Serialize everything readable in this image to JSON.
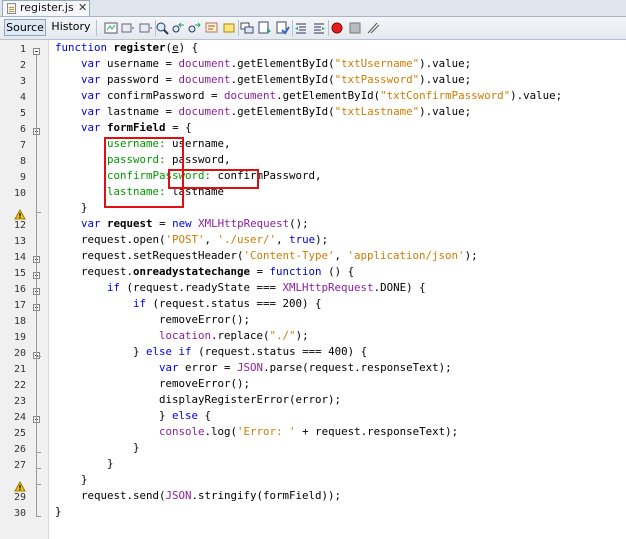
{
  "editor": {
    "tab_title": "register.js",
    "tab_close": "✕",
    "source_label": "Source",
    "history_label": "History"
  },
  "toolbar_icons": [
    "last-edit-icon",
    "back-icon",
    "forward-icon",
    "find-icon",
    "find-previous-icon",
    "find-next-icon",
    "find-selection-icon",
    "toggle-highlight-icon",
    "toggle-rectangular-icon",
    "toggle-bookmark-icon",
    "next-bookmark-icon",
    "shift-left-icon",
    "shift-right-icon",
    "record-macro-icon",
    "stop-macro-icon",
    "comment-icon"
  ],
  "gutter": {
    "line_numbers": [
      "1",
      "2",
      "3",
      "4",
      "5",
      "6",
      "7",
      "8",
      "9",
      "10",
      "11",
      "12",
      "13",
      "14",
      "15",
      "16",
      "17",
      "18",
      "19",
      "20",
      "21",
      "22",
      "23",
      "24",
      "25",
      "26",
      "27",
      "28",
      "29",
      "30"
    ],
    "warning_lines": [
      11,
      28
    ],
    "fold_lines": [
      1,
      6,
      14,
      15,
      16,
      17,
      20,
      24
    ]
  },
  "code_lines": [
    [
      {
        "t": "function",
        "c": "kw"
      },
      {
        "t": " "
      },
      {
        "t": "register",
        "c": "bold"
      },
      {
        "t": "("
      },
      {
        "t": "e",
        "c": "ul"
      },
      {
        "t": ") {"
      }
    ],
    [
      {
        "t": "    "
      },
      {
        "t": "var",
        "c": "kw"
      },
      {
        "t": " username = "
      },
      {
        "t": "document",
        "c": "glob"
      },
      {
        "t": ".getElementById("
      },
      {
        "t": "\"txtUsername\"",
        "c": "str"
      },
      {
        "t": ").value;"
      }
    ],
    [
      {
        "t": "    "
      },
      {
        "t": "var",
        "c": "kw"
      },
      {
        "t": " password = "
      },
      {
        "t": "document",
        "c": "glob"
      },
      {
        "t": ".getElementById("
      },
      {
        "t": "\"txtPassword\"",
        "c": "str"
      },
      {
        "t": ").value;"
      }
    ],
    [
      {
        "t": "    "
      },
      {
        "t": "var",
        "c": "kw"
      },
      {
        "t": " confirmPassword = "
      },
      {
        "t": "document",
        "c": "glob"
      },
      {
        "t": ".getElementById("
      },
      {
        "t": "\"txtConfirmPassword\"",
        "c": "str"
      },
      {
        "t": ").value;"
      }
    ],
    [
      {
        "t": "    "
      },
      {
        "t": "var",
        "c": "kw"
      },
      {
        "t": " lastname = "
      },
      {
        "t": "document",
        "c": "glob"
      },
      {
        "t": ".getElementById("
      },
      {
        "t": "\"txtLastname\"",
        "c": "str"
      },
      {
        "t": ").value;"
      }
    ],
    [
      {
        "t": "    "
      },
      {
        "t": "var",
        "c": "kw"
      },
      {
        "t": " "
      },
      {
        "t": "formField",
        "c": "bold"
      },
      {
        "t": " = {"
      }
    ],
    [
      {
        "t": "        "
      },
      {
        "t": "username:",
        "c": "prop"
      },
      {
        "t": " username,"
      }
    ],
    [
      {
        "t": "        "
      },
      {
        "t": "password:",
        "c": "prop"
      },
      {
        "t": " password,"
      }
    ],
    [
      {
        "t": "        "
      },
      {
        "t": "confirmPassword:",
        "c": "prop"
      },
      {
        "t": " confirmPassword,"
      }
    ],
    [
      {
        "t": "        "
      },
      {
        "t": "lastname:",
        "c": "prop"
      },
      {
        "t": " lastname"
      }
    ],
    [
      {
        "t": "    }"
      }
    ],
    [
      {
        "t": "    "
      },
      {
        "t": "var",
        "c": "kw"
      },
      {
        "t": " "
      },
      {
        "t": "request",
        "c": "bold"
      },
      {
        "t": " = "
      },
      {
        "t": "new",
        "c": "kw"
      },
      {
        "t": " "
      },
      {
        "t": "XMLHttpRequest",
        "c": "glob"
      },
      {
        "t": "();"
      }
    ],
    [
      {
        "t": "    request.open("
      },
      {
        "t": "'POST'",
        "c": "str"
      },
      {
        "t": ", "
      },
      {
        "t": "'./user/'",
        "c": "str"
      },
      {
        "t": ", "
      },
      {
        "t": "true",
        "c": "kw"
      },
      {
        "t": ");"
      }
    ],
    [
      {
        "t": "    request.setRequestHeader("
      },
      {
        "t": "'Content-Type'",
        "c": "str"
      },
      {
        "t": ", "
      },
      {
        "t": "'application/json'",
        "c": "str"
      },
      {
        "t": ");"
      }
    ],
    [
      {
        "t": "    request."
      },
      {
        "t": "onreadystatechange",
        "c": "bold"
      },
      {
        "t": " = "
      },
      {
        "t": "function",
        "c": "kw"
      },
      {
        "t": " () {"
      }
    ],
    [
      {
        "t": "        "
      },
      {
        "t": "if",
        "c": "kw"
      },
      {
        "t": " (request.readyState === "
      },
      {
        "t": "XMLHttpRequest",
        "c": "glob"
      },
      {
        "t": ".DONE) {"
      }
    ],
    [
      {
        "t": "            "
      },
      {
        "t": "if",
        "c": "kw"
      },
      {
        "t": " (request.status === 200) {"
      }
    ],
    [
      {
        "t": "                removeError();"
      }
    ],
    [
      {
        "t": "                "
      },
      {
        "t": "location",
        "c": "glob"
      },
      {
        "t": ".replace("
      },
      {
        "t": "\"./\"",
        "c": "str"
      },
      {
        "t": ");"
      }
    ],
    [
      {
        "t": "            } "
      },
      {
        "t": "else",
        "c": "kw"
      },
      {
        "t": " "
      },
      {
        "t": "if",
        "c": "kw"
      },
      {
        "t": " (request.status === 400) {"
      }
    ],
    [
      {
        "t": "                "
      },
      {
        "t": "var",
        "c": "kw"
      },
      {
        "t": " error = "
      },
      {
        "t": "JSON",
        "c": "glob"
      },
      {
        "t": ".parse(request.responseText);"
      }
    ],
    [
      {
        "t": "                removeError();"
      }
    ],
    [
      {
        "t": "                displayRegisterError(error);"
      }
    ],
    [
      {
        "t": "                } "
      },
      {
        "t": "else",
        "c": "kw"
      },
      {
        "t": " {"
      }
    ],
    [
      {
        "t": "                "
      },
      {
        "t": "console",
        "c": "glob"
      },
      {
        "t": ".log("
      },
      {
        "t": "'Error: '",
        "c": "str"
      },
      {
        "t": " + request.responseText);"
      }
    ],
    [
      {
        "t": "            }"
      }
    ],
    [
      {
        "t": "        }"
      }
    ],
    [
      {
        "t": "    }"
      }
    ],
    [
      {
        "t": "    request.send("
      },
      {
        "t": "JSON",
        "c": "glob"
      },
      {
        "t": ".stringify(formField));"
      }
    ],
    [
      {
        "t": "}"
      }
    ]
  ],
  "colors": {
    "keyword": "#0000e6",
    "string": "#ce7b00",
    "global": "#8c1fa0",
    "property": "#009900",
    "annotation": "#e01010",
    "warning": "#f2c200"
  }
}
